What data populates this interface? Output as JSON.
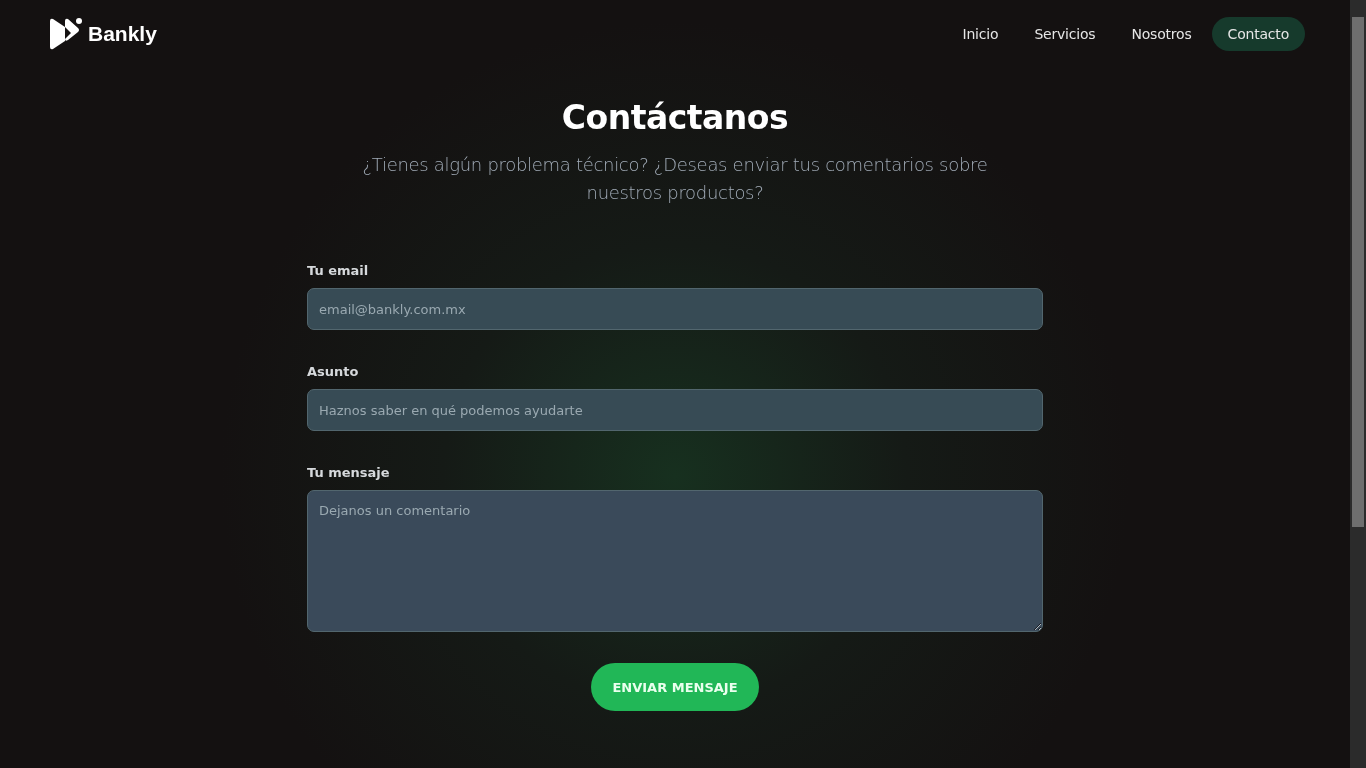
{
  "brand": "Bankly",
  "nav": [
    {
      "label": "Inicio",
      "selected": false
    },
    {
      "label": "Servicios",
      "selected": false
    },
    {
      "label": "Nosotros",
      "selected": false
    },
    {
      "label": "Contacto",
      "selected": true
    }
  ],
  "heading": "Contáctanos",
  "subtitle": "¿Tienes algún problema técnico? ¿Deseas enviar tus comentarios sobre nuestros productos?",
  "fields": [
    {
      "kind": "input",
      "label": "Tu email",
      "placeholder": "email@bankly.com.mx"
    },
    {
      "kind": "input",
      "label": "Asunto",
      "placeholder": "Haznos saber en qué podemos ayudarte"
    },
    {
      "kind": "textarea",
      "label": "Tu mensaje",
      "placeholder": "Dejanos un comentario"
    }
  ],
  "submit": "ENVIAR MENSAJE"
}
